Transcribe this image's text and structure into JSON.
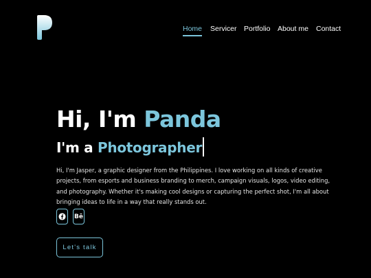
{
  "logo_icon": "p-logo-icon",
  "nav": {
    "home": "Home",
    "services": "Servicer",
    "portfolio": "Portfolio",
    "about": "About me",
    "contact": "Contact"
  },
  "hero": {
    "greeting": "Hi, I'm ",
    "name": "Panda",
    "role_prefix": "I'm a ",
    "role": "Photographer",
    "bio": "Hi, I'm Jasper, a graphic designer from the Philippines. I love working on all kinds of creative projects, from esports and business branding to merch, campaign visuals, logos, video editing, and photography. Whether it's making cool designs or capturing the perfect shot, I'm all about bringing ideas to life in a way that really stands out."
  },
  "social": {
    "facebook_icon": "facebook-icon",
    "behance_label": "Bē"
  },
  "cta": {
    "label": "Let's talk"
  },
  "colors": {
    "accent": "#7cc6dc",
    "background": "#000000",
    "text": "#ffffff"
  }
}
